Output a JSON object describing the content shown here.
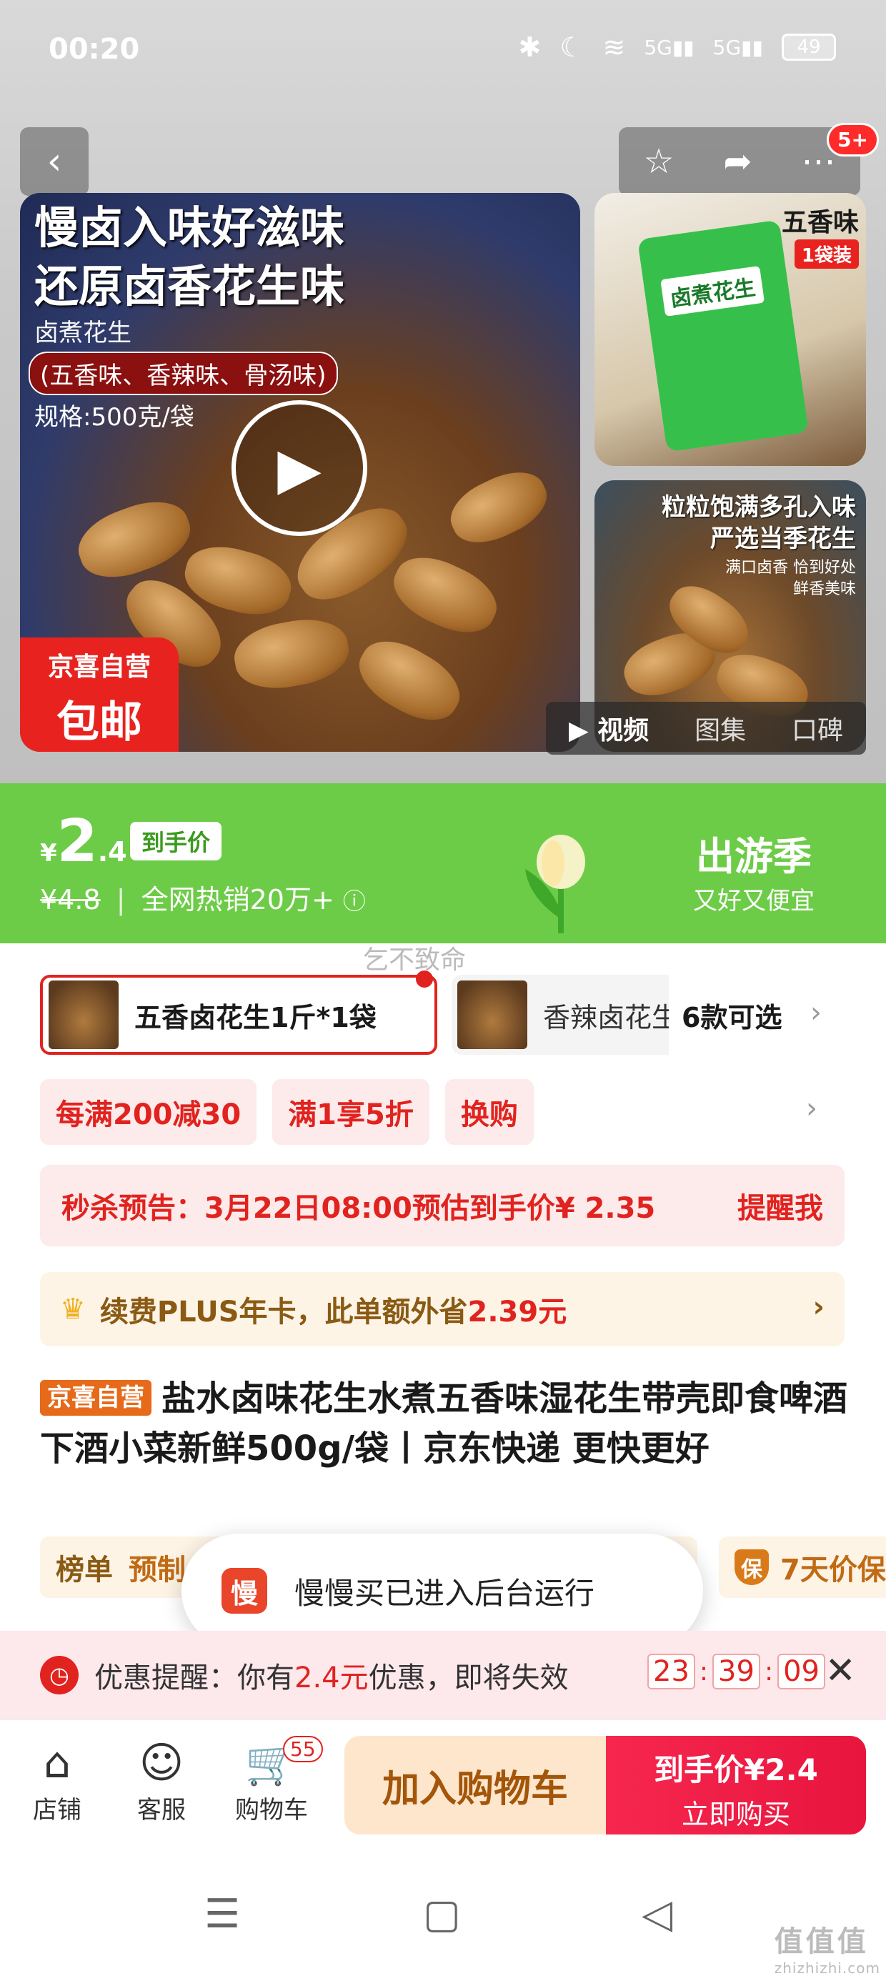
{
  "status_bar": {
    "time": "00:20",
    "battery": "49",
    "signal1": "5G",
    "signal2": "5G"
  },
  "nav": {
    "back_icon": "chevron-left-icon",
    "cart_count_badge": "5+"
  },
  "gallery": {
    "main_title_line1": "慢卤入味好滋味",
    "main_title_line2": "还原卤香花生味",
    "main_sub1": "卤煮花生",
    "main_sub2": "(五香味、香辣味、骨汤味)",
    "main_sub3": "规格:500克/袋",
    "badge_line1": "京喜自营",
    "badge_line2": "包邮",
    "thumb1_label": "五香味",
    "thumb1_tag": "1袋装",
    "thumb1_bag_text": "卤煮花生",
    "thumb2_line1": "粒粒饱满多孔入味",
    "thumb2_line2": "严选当季花生",
    "thumb2_line3": "满口卤香 恰到好处",
    "thumb2_line4": "鲜香美味",
    "media_tabs": [
      "视频",
      "图集",
      "口碑"
    ]
  },
  "price": {
    "currency": "¥",
    "integer": "2",
    "decimal": ".4",
    "tag": "到手价",
    "original": "¥4.8",
    "sales": "全网热销20万+",
    "season_title": "出游季",
    "season_sub": "又好又便宜"
  },
  "watermark": "乞不致命",
  "spec": {
    "selected": "五香卤花生1斤*1袋",
    "second": "香辣卤花生",
    "more": "6款可选"
  },
  "promos": [
    "每满200减30",
    "满1享5折",
    "换购"
  ],
  "seckill": {
    "text": "秒杀预告：3月22日08:00预估到手价¥ 2.35",
    "remind": "提醒我"
  },
  "plus": {
    "prefix": "续费PLUS年卡，此单额外省",
    "amount": "2.39元"
  },
  "product": {
    "self_tag": "京喜自营",
    "title": "盐水卤味花生水煮五香味湿花生带壳即食啤酒下酒小菜新鲜500g/袋丨京东快递 更快更好"
  },
  "ranking": {
    "label1": "榜单",
    "label2": "预制"
  },
  "price_protect": {
    "label": "7天价保",
    "icon_text": "保"
  },
  "toast": {
    "app_icon_text": "慢",
    "message": "慢慢买已进入后台运行"
  },
  "coupon": {
    "prefix": "优惠提醒：你有",
    "amount": "2.4元",
    "suffix": "优惠，即将失效",
    "hh": "23",
    "mm": "39",
    "ss": "09"
  },
  "bottom_bar": {
    "store": "店铺",
    "service": "客服",
    "cart": "购物车",
    "cart_count": "55",
    "add_cart": "加入购物车",
    "buy_price": "到手价¥2.4",
    "buy_now": "立即购买"
  },
  "site_mark": {
    "text": "值值值",
    "url": "zhizhizhi.com"
  },
  "colors": {
    "accent_red": "#e1231f",
    "price_green": "#6dcc47",
    "orange": "#e66a1a"
  }
}
